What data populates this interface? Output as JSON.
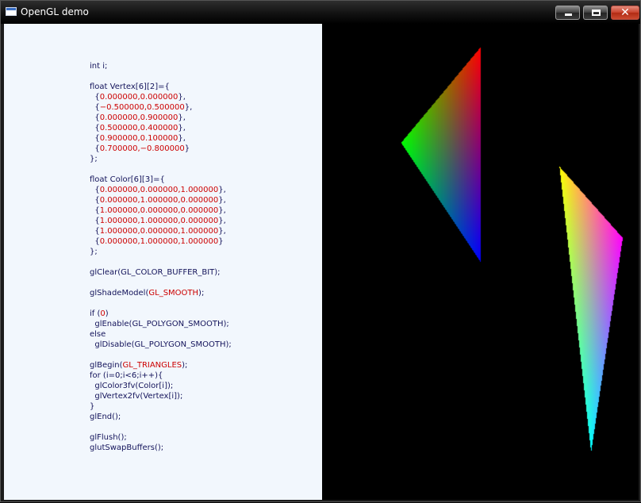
{
  "window": {
    "title": "OpenGL demo",
    "controls": {
      "minimize": "minimize",
      "maximize": "maximize",
      "close": "✕"
    }
  },
  "code_lines": [
    [
      {
        "t": "int i;"
      }
    ],
    [],
    [
      {
        "t": "float Vertex[6][2]={"
      }
    ],
    [
      {
        "t": "  {"
      },
      {
        "t": "0.000000,0.000000",
        "v": true
      },
      {
        "t": "},"
      }
    ],
    [
      {
        "t": "  {"
      },
      {
        "t": "−0.500000,0.500000",
        "v": true
      },
      {
        "t": "},"
      }
    ],
    [
      {
        "t": "  {"
      },
      {
        "t": "0.000000,0.900000",
        "v": true
      },
      {
        "t": "},"
      }
    ],
    [
      {
        "t": "  {"
      },
      {
        "t": "0.500000,0.400000",
        "v": true
      },
      {
        "t": "},"
      }
    ],
    [
      {
        "t": "  {"
      },
      {
        "t": "0.900000,0.100000",
        "v": true
      },
      {
        "t": "},"
      }
    ],
    [
      {
        "t": "  {"
      },
      {
        "t": "0.700000,−0.800000",
        "v": true
      },
      {
        "t": "}"
      }
    ],
    [
      {
        "t": "};"
      }
    ],
    [],
    [
      {
        "t": "float Color[6][3]={"
      }
    ],
    [
      {
        "t": "  {"
      },
      {
        "t": "0.000000,0.000000,1.000000",
        "v": true
      },
      {
        "t": "},"
      }
    ],
    [
      {
        "t": "  {"
      },
      {
        "t": "0.000000,1.000000,0.000000",
        "v": true
      },
      {
        "t": "},"
      }
    ],
    [
      {
        "t": "  {"
      },
      {
        "t": "1.000000,0.000000,0.000000",
        "v": true
      },
      {
        "t": "},"
      }
    ],
    [
      {
        "t": "  {"
      },
      {
        "t": "1.000000,1.000000,0.000000",
        "v": true
      },
      {
        "t": "},"
      }
    ],
    [
      {
        "t": "  {"
      },
      {
        "t": "1.000000,0.000000,1.000000",
        "v": true
      },
      {
        "t": "},"
      }
    ],
    [
      {
        "t": "  {"
      },
      {
        "t": "0.000000,1.000000,1.000000",
        "v": true
      },
      {
        "t": "}"
      }
    ],
    [
      {
        "t": "};"
      }
    ],
    [],
    [
      {
        "t": "glClear(GL_COLOR_BUFFER_BIT);"
      }
    ],
    [],
    [
      {
        "t": "glShadeModel("
      },
      {
        "t": "GL_SMOOTH",
        "v": true
      },
      {
        "t": ");"
      }
    ],
    [],
    [
      {
        "t": "if ("
      },
      {
        "t": "0",
        "v": true
      },
      {
        "t": ")"
      }
    ],
    [
      {
        "t": "  glEnable(GL_POLYGON_SMOOTH);"
      }
    ],
    [
      {
        "t": "else"
      }
    ],
    [
      {
        "t": "  glDisable(GL_POLYGON_SMOOTH);"
      }
    ],
    [],
    [
      {
        "t": "glBegin("
      },
      {
        "t": "GL_TRIANGLES",
        "v": true
      },
      {
        "t": ");"
      }
    ],
    [
      {
        "t": "for (i=0;i<6;i++){"
      }
    ],
    [
      {
        "t": "  glColor3fv(Color[i]);"
      }
    ],
    [
      {
        "t": "  glVertex2fv(Vertex[i]);"
      }
    ],
    [
      {
        "t": "}"
      }
    ],
    [
      {
        "t": "glEnd();"
      }
    ],
    [],
    [
      {
        "t": "glFlush();"
      }
    ],
    [
      {
        "t": "glutSwapBuffers();"
      }
    ]
  ],
  "colors": {
    "code_text": "#13135a",
    "code_value": "#cc0000",
    "code_background": "#f2f7fd",
    "viewport_background": "#000000"
  },
  "scene": {
    "primitive": "GL_TRIANGLES",
    "shade_model": "GL_SMOOTH",
    "vertices": [
      [
        0.0,
        0.0
      ],
      [
        -0.5,
        0.5
      ],
      [
        0.0,
        0.9
      ],
      [
        0.5,
        0.4
      ],
      [
        0.9,
        0.1
      ],
      [
        0.7,
        -0.8
      ]
    ],
    "vertex_colors": [
      [
        0.0,
        0.0,
        1.0
      ],
      [
        0.0,
        1.0,
        0.0
      ],
      [
        1.0,
        0.0,
        0.0
      ],
      [
        1.0,
        1.0,
        0.0
      ],
      [
        1.0,
        0.0,
        1.0
      ],
      [
        0.0,
        1.0,
        1.0
      ]
    ]
  }
}
